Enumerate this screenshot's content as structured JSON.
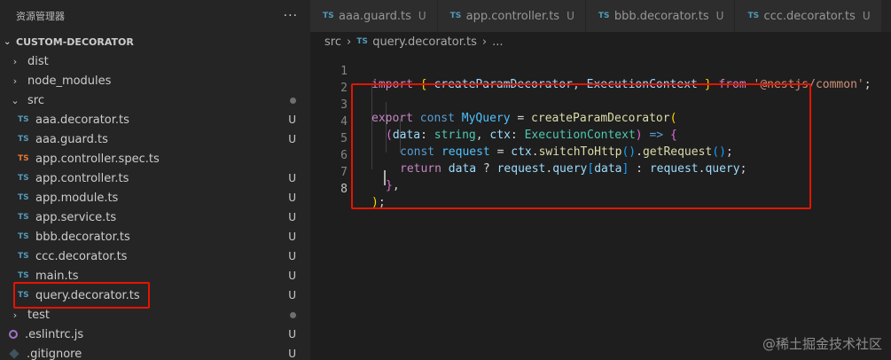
{
  "sidebar": {
    "title": "资源管理器",
    "more": "···",
    "project": "CUSTOM-DECORATOR",
    "items": [
      {
        "label": "dist",
        "type": "folder",
        "state": "collapsed",
        "indent": 1,
        "status": ""
      },
      {
        "label": "node_modules",
        "type": "folder",
        "state": "collapsed",
        "indent": 1,
        "status": ""
      },
      {
        "label": "src",
        "type": "folder",
        "state": "expanded",
        "indent": 1,
        "status": "dot"
      },
      {
        "label": "aaa.decorator.ts",
        "type": "ts",
        "indent": 2,
        "status": "U"
      },
      {
        "label": "aaa.guard.ts",
        "type": "ts",
        "indent": 2,
        "status": "U"
      },
      {
        "label": "app.controller.spec.ts",
        "type": "ts-spec",
        "indent": 2,
        "status": ""
      },
      {
        "label": "app.controller.ts",
        "type": "ts",
        "indent": 2,
        "status": "U"
      },
      {
        "label": "app.module.ts",
        "type": "ts",
        "indent": 2,
        "status": "U"
      },
      {
        "label": "app.service.ts",
        "type": "ts",
        "indent": 2,
        "status": "U"
      },
      {
        "label": "bbb.decorator.ts",
        "type": "ts",
        "indent": 2,
        "status": "U"
      },
      {
        "label": "ccc.decorator.ts",
        "type": "ts",
        "indent": 2,
        "status": "U"
      },
      {
        "label": "main.ts",
        "type": "ts",
        "indent": 2,
        "status": "U"
      },
      {
        "label": "query.decorator.ts",
        "type": "ts",
        "indent": 2,
        "status": "U",
        "highlight": true
      },
      {
        "label": "test",
        "type": "folder",
        "state": "collapsed",
        "indent": 1,
        "status": "dot"
      },
      {
        "label": ".eslintrc.js",
        "type": "eslint",
        "indent": 1,
        "status": "U"
      },
      {
        "label": ".gitignore",
        "type": "git",
        "indent": 1,
        "status": "U"
      }
    ]
  },
  "tabs": [
    {
      "label": "aaa.guard.ts",
      "status": "U"
    },
    {
      "label": "app.controller.ts",
      "status": "U"
    },
    {
      "label": "bbb.decorator.ts",
      "status": "U"
    },
    {
      "label": "ccc.decorator.ts",
      "status": "U"
    }
  ],
  "icons": {
    "ts": "TS",
    "folder_collapsed": "›",
    "folder_expanded": "⌄"
  },
  "breadcrumb": {
    "folder": "src",
    "file": "query.decorator.ts",
    "tail": "..."
  },
  "code": {
    "line_numbers": [
      "1",
      "2",
      "3",
      "4",
      "5",
      "6",
      "7",
      "8"
    ],
    "l1": {
      "import": "import",
      "ob": "{",
      "a": " createParamDecorator, ",
      "b": "ExecutionContext",
      "cb": "}",
      "from": " from ",
      "mod": "'@nestjs/common'",
      "semi": ";"
    },
    "l3": {
      "export": "export",
      "const": " const ",
      "name": "MyQuery",
      "eq": " = ",
      "fn": "createParamDecorator",
      "op": "("
    },
    "l4": {
      "op": "(",
      "data": "data",
      "c1": ": ",
      "t1": "string",
      "c2": ", ",
      "ctx": "ctx",
      "c3": ": ",
      "t2": "ExecutionContext",
      "cp": ")",
      "arrow": " => ",
      "ob": "{"
    },
    "l5": {
      "const": "const",
      "sp": " ",
      "req": "request",
      "eq": " = ",
      "ctx": "ctx",
      "dot1": ".",
      "f1": "switchToHttp",
      "p1": "()",
      "dot2": ".",
      "f2": "getRequest",
      "p2": "()",
      "semi": ";"
    },
    "l6": {
      "ret": "return",
      "sp": " ",
      "data": "data",
      "q": " ? ",
      "req": "request",
      "dot": ".",
      "query": "query",
      "ob": "[",
      "data2": "data",
      "cb": "]",
      "col": " : ",
      "req2": "request",
      "dot2": ".",
      "query2": "query",
      "semi": ";"
    },
    "l7": {
      "cb": "}",
      "comma": ","
    },
    "l8": {
      "cp": ")",
      "semi": ";"
    }
  },
  "watermark": "@稀土掘金技术社区",
  "colors": {
    "highlight_border": "#e51400",
    "ts_icon": "#519aba",
    "spec_icon": "#e37933"
  }
}
